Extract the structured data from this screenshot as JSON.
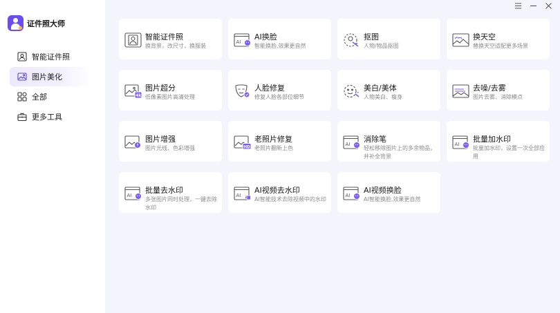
{
  "app": {
    "name": "证件照大师"
  },
  "sidebar": {
    "items": [
      {
        "label": "智能证件照",
        "icon": "id-photo-icon",
        "active": false
      },
      {
        "label": "图片美化",
        "icon": "image-beautify-icon",
        "active": true
      },
      {
        "label": "全部",
        "icon": "grid-icon",
        "active": false
      },
      {
        "label": "更多工具",
        "icon": "toolbox-icon",
        "active": false
      }
    ]
  },
  "window_controls": {
    "menu": "menu-icon",
    "minimize": "minimize-icon",
    "close": "close-icon"
  },
  "colors": {
    "accent": "#6a4ef2",
    "badge": "#7b5cf7",
    "icon_stroke": "#555555",
    "content_bg": "#f4f5fc"
  },
  "tools": [
    {
      "title": "智能证件照",
      "desc": "换背景，改尺寸，换服装",
      "icon": "id-photo-icon"
    },
    {
      "title": "AI换脸",
      "desc": "智能换脸,效果更自然",
      "icon": "ai-face-swap-icon"
    },
    {
      "title": "抠图",
      "desc": "人物/物品抠图",
      "icon": "cutout-icon"
    },
    {
      "title": "换天空",
      "desc": "替换天空适配更多场景",
      "icon": "sky-replace-icon"
    },
    {
      "title": "图片超分",
      "desc": "低像素图片高清处理",
      "icon": "super-resolution-icon"
    },
    {
      "title": "人脸修复",
      "desc": "修复人脸各部位细节",
      "icon": "face-repair-icon"
    },
    {
      "title": "美白/美体",
      "desc": "人物美白、瘦身",
      "icon": "whiten-slim-icon"
    },
    {
      "title": "去噪/去雾",
      "desc": "图片去雾、消除模点",
      "icon": "denoise-icon"
    },
    {
      "title": "图片增强",
      "desc": "图片光线、色彩增强",
      "icon": "image-enhance-icon"
    },
    {
      "title": "老照片修复",
      "desc": "老照片翻新上色",
      "icon": "old-photo-hd-icon"
    },
    {
      "title": "消除笔",
      "desc": "轻松移除图片上的多余物品，并补全背景",
      "icon": "eraser-icon"
    },
    {
      "title": "批量加水印",
      "desc": "批量加水印，设置一次全部应用",
      "icon": "batch-watermark-icon"
    },
    {
      "title": "批量去水印",
      "desc": "多张图片同时处理，一键去除水印",
      "icon": "batch-remove-watermark-icon"
    },
    {
      "title": "AI视频去水印",
      "desc": "AI智能技术去除视频中的水印",
      "icon": "video-remove-watermark-icon"
    },
    {
      "title": "AI视频换脸",
      "desc": "AI智能换脸,效果更自然",
      "icon": "video-face-swap-icon"
    }
  ]
}
